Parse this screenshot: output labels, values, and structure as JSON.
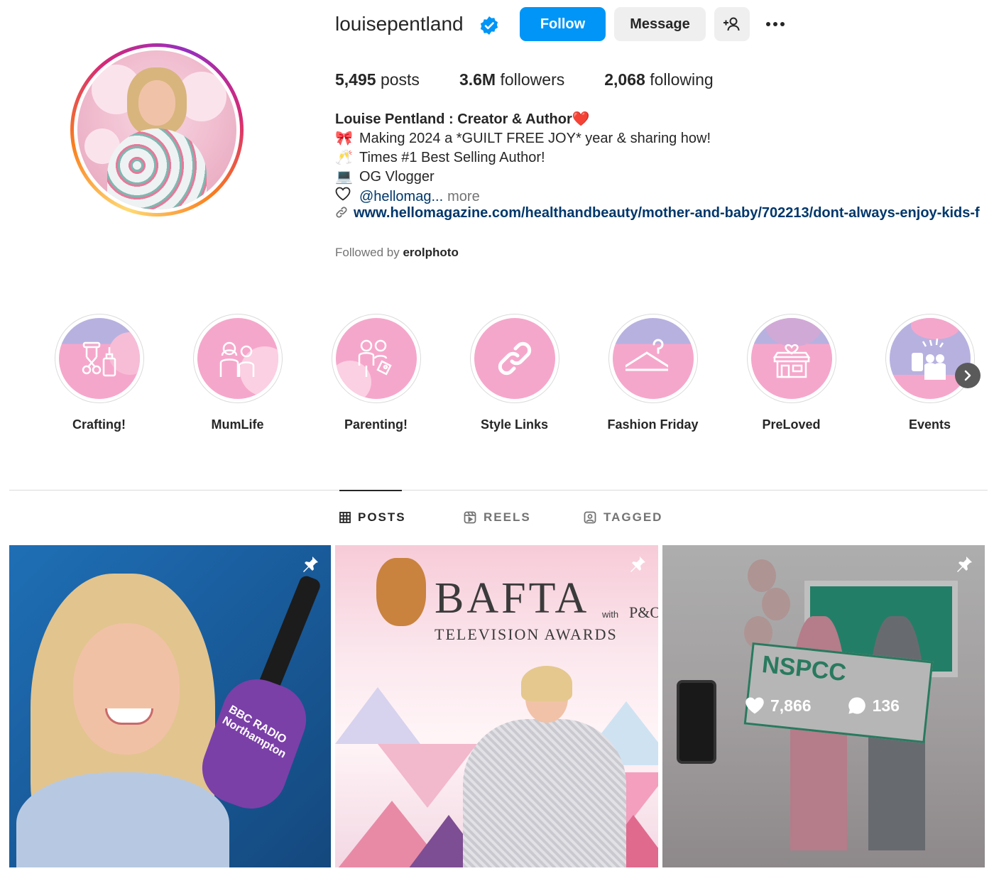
{
  "profile": {
    "username": "louisepentland",
    "verified": true,
    "buttons": {
      "follow": "Follow",
      "message": "Message"
    },
    "stats": {
      "posts_count": "5,495",
      "posts_label": "posts",
      "followers_count": "3.6M",
      "followers_label": "followers",
      "following_count": "2,068",
      "following_label": "following"
    },
    "bio": {
      "name": "Louise Pentland : Creator & Author",
      "name_emoji": "❤️",
      "lines": [
        {
          "emoji": "🎀",
          "text": "Making 2024 a *GUILT FREE JOY* year & sharing how!"
        },
        {
          "emoji": "🥂",
          "text": "Times #1 Best Selling Author!"
        },
        {
          "emoji": "💻",
          "text": "OG Vlogger"
        }
      ],
      "mention": "@hellomag...",
      "more": "more",
      "link": "www.hellomagazine.com/healthandbeauty/mother-and-baby/702213/dont-always-enjoy-kids-f"
    },
    "followed_by_prefix": "Followed by",
    "followed_by_user": "erolphoto"
  },
  "highlights": [
    {
      "label": "Crafting!",
      "icon": "scissors-bottle-icon"
    },
    {
      "label": "MumLife",
      "icon": "mother-child-icon"
    },
    {
      "label": "Parenting!",
      "icon": "parents-icon"
    },
    {
      "label": "Style Links",
      "icon": "link-icon"
    },
    {
      "label": "Fashion Friday",
      "icon": "hanger-icon"
    },
    {
      "label": "PreLoved",
      "icon": "shop-icon"
    },
    {
      "label": "Events",
      "icon": "party-icon"
    }
  ],
  "tabs": [
    {
      "label": "POSTS",
      "icon": "grid-icon",
      "active": true
    },
    {
      "label": "REELS",
      "icon": "reels-icon",
      "active": false
    },
    {
      "label": "TAGGED",
      "icon": "tagged-icon",
      "active": false
    }
  ],
  "posts": [
    {
      "pinned": true,
      "mic_text": "BBC RADIO Northampton"
    },
    {
      "pinned": true,
      "bafta_title": "BAFTA",
      "bafta_subtitle": "TELEVISION AWARDS",
      "bafta_with": "with",
      "bafta_sponsor": "P&O"
    },
    {
      "pinned": true,
      "cheque_text": "NSPCC",
      "likes": "7,866",
      "comments": "136"
    }
  ],
  "colors": {
    "accent": "#0095f6",
    "link": "#00376b",
    "muted": "#737373",
    "highlight_pink": "#f5a7cb",
    "highlight_lilac": "#b7b1e0"
  }
}
